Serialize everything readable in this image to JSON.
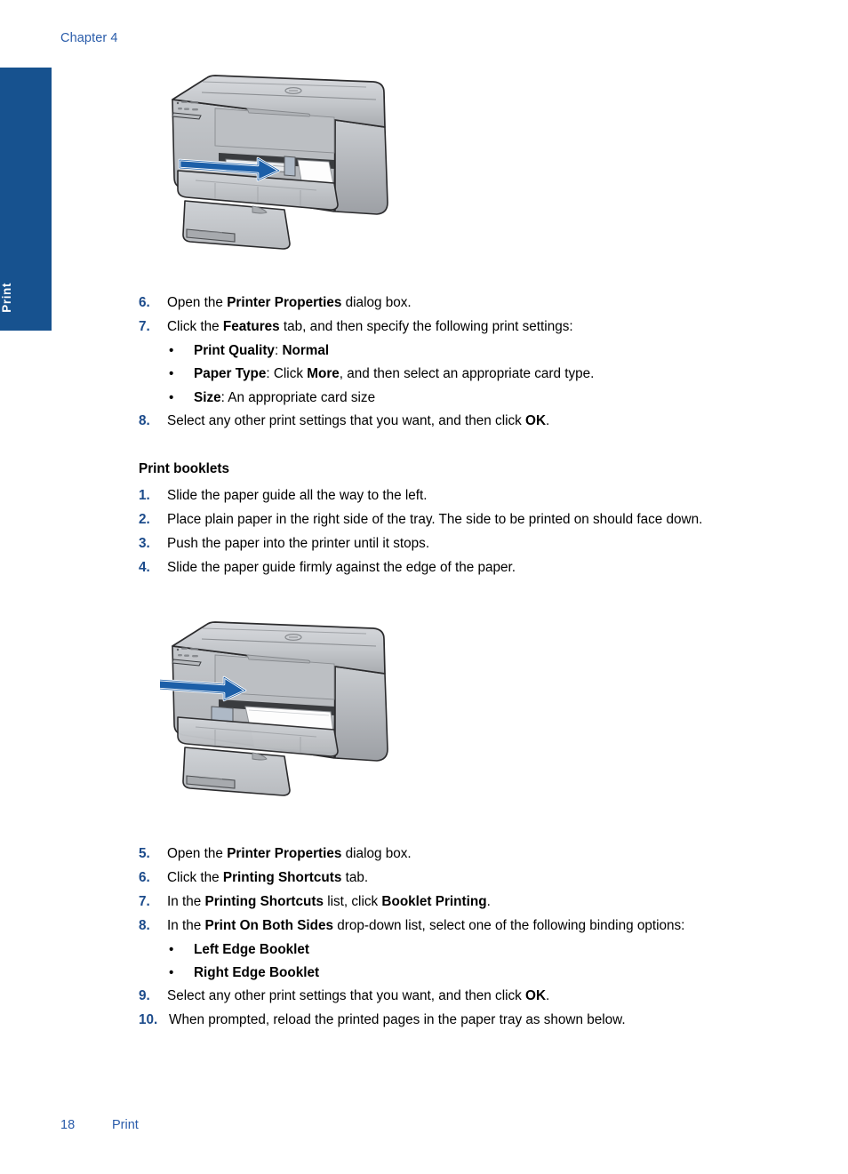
{
  "header": {
    "chapter": "Chapter 4"
  },
  "side_tab": {
    "label": "Print",
    "color": "#17528f"
  },
  "colors": {
    "accent_blue": "#1c4b8b",
    "link_blue": "#2a5caa",
    "arrow_blue": "#1c5fa8",
    "printer_body": "#b4b6b9"
  },
  "cards_steps": {
    "items": [
      {
        "num": "6.",
        "parts": [
          {
            "t": "Open the ",
            "b": false
          },
          {
            "t": "Printer Properties",
            "b": true
          },
          {
            "t": " dialog box.",
            "b": false
          }
        ]
      },
      {
        "num": "7.",
        "parts": [
          {
            "t": "Click the ",
            "b": false
          },
          {
            "t": "Features",
            "b": true
          },
          {
            "t": " tab, and then specify the following print settings:",
            "b": false
          }
        ],
        "bullets": [
          [
            {
              "t": "Print Quality",
              "b": true
            },
            {
              "t": ": ",
              "b": false
            },
            {
              "t": "Normal",
              "b": true
            }
          ],
          [
            {
              "t": "Paper Type",
              "b": true
            },
            {
              "t": ": Click ",
              "b": false
            },
            {
              "t": "More",
              "b": true
            },
            {
              "t": ", and then select an appropriate card type.",
              "b": false
            }
          ],
          [
            {
              "t": "Size",
              "b": true
            },
            {
              "t": ": An appropriate card size",
              "b": false
            }
          ]
        ]
      },
      {
        "num": "8.",
        "parts": [
          {
            "t": "Select any other print settings that you want, and then click ",
            "b": false
          },
          {
            "t": "OK",
            "b": true
          },
          {
            "t": ".",
            "b": false
          }
        ]
      }
    ]
  },
  "booklets_section": {
    "heading": "Print booklets",
    "items": [
      {
        "num": "1.",
        "parts": [
          {
            "t": "Slide the paper guide all the way to the left.",
            "b": false
          }
        ]
      },
      {
        "num": "2.",
        "parts": [
          {
            "t": "Place plain paper in the right side of the tray. The side to be printed on should face down.",
            "b": false
          }
        ]
      },
      {
        "num": "3.",
        "parts": [
          {
            "t": "Push the paper into the printer until it stops.",
            "b": false
          }
        ]
      },
      {
        "num": "4.",
        "parts": [
          {
            "t": "Slide the paper guide firmly against the edge of the paper.",
            "b": false
          }
        ]
      }
    ]
  },
  "booklets_steps": {
    "items": [
      {
        "num": "5.",
        "parts": [
          {
            "t": "Open the ",
            "b": false
          },
          {
            "t": "Printer Properties",
            "b": true
          },
          {
            "t": " dialog box.",
            "b": false
          }
        ]
      },
      {
        "num": "6.",
        "parts": [
          {
            "t": "Click the ",
            "b": false
          },
          {
            "t": "Printing Shortcuts",
            "b": true
          },
          {
            "t": " tab.",
            "b": false
          }
        ]
      },
      {
        "num": "7.",
        "parts": [
          {
            "t": "In the ",
            "b": false
          },
          {
            "t": "Printing Shortcuts",
            "b": true
          },
          {
            "t": " list, click ",
            "b": false
          },
          {
            "t": "Booklet Printing",
            "b": true
          },
          {
            "t": ".",
            "b": false
          }
        ]
      },
      {
        "num": "8.",
        "parts": [
          {
            "t": "In the ",
            "b": false
          },
          {
            "t": "Print On Both Sides",
            "b": true
          },
          {
            "t": " drop-down list, select one of the following binding options:",
            "b": false
          }
        ],
        "bullets": [
          [
            {
              "t": "Left Edge Booklet",
              "b": true
            }
          ],
          [
            {
              "t": "Right Edge Booklet",
              "b": true
            }
          ]
        ]
      },
      {
        "num": "9.",
        "parts": [
          {
            "t": "Select any other print settings that you want, and then click ",
            "b": false
          },
          {
            "t": "OK",
            "b": true
          },
          {
            "t": ".",
            "b": false
          }
        ]
      },
      {
        "num": "10.",
        "wide": true,
        "parts": [
          {
            "t": "When prompted, reload the printed pages in the paper tray as shown below.",
            "b": false
          }
        ]
      }
    ]
  },
  "figures": [
    {
      "name": "printer-card-loading-figure",
      "variant": "cards"
    },
    {
      "name": "printer-booklet-loading-figure",
      "variant": "booklet"
    }
  ],
  "footer": {
    "page_number": "18",
    "section": "Print"
  }
}
